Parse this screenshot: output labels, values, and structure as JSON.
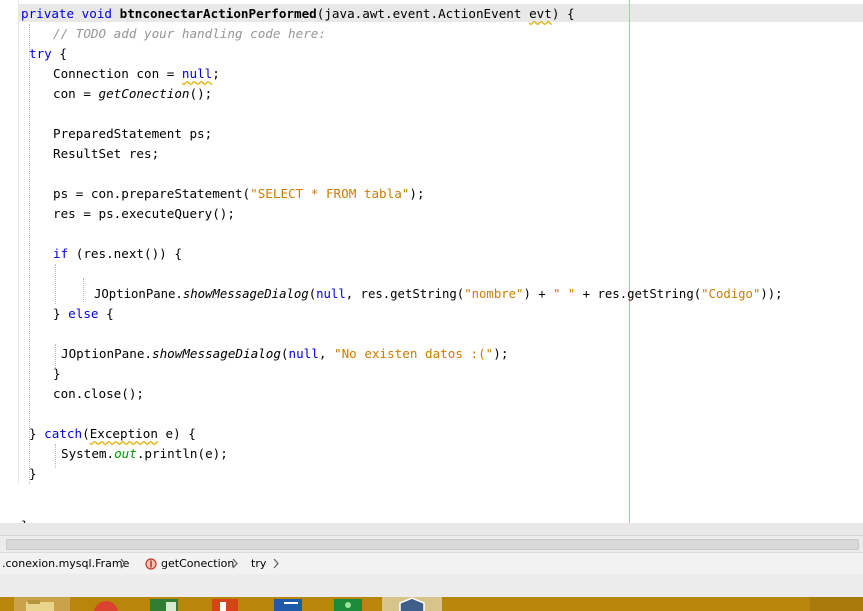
{
  "code": {
    "line1": {
      "kw_private": "private",
      "kw_void": "void",
      "method_name": "btnconectarActionPerformed",
      "params_start": "(java.awt.event.ActionEvent ",
      "param_name": "evt",
      "params_end": ") {"
    },
    "line2": {
      "comment": "// TODO add your handling code here:"
    },
    "line3": {
      "kw_try": "try",
      "rest": " {"
    },
    "line4": {
      "pre": "Connection con = ",
      "kw_null": "null",
      "post": ";"
    },
    "line5": {
      "pre": "con = ",
      "method": "getConection",
      "post": "();"
    },
    "line7": {
      "text": "PreparedStatement ps;"
    },
    "line8": {
      "text": "ResultSet res;"
    },
    "line10": {
      "pre": "ps = con.prepareStatement(",
      "str": "\"SELECT * FROM tabla\"",
      "post": ");"
    },
    "line11": {
      "text": "res = ps.executeQuery();"
    },
    "line13": {
      "kw_if": "if",
      "rest": " (res.next()) {"
    },
    "line15": {
      "pre": "JOptionPane.",
      "method": "showMessageDialog",
      "open": "(",
      "kw_null": "null",
      "mid1": ", res.getString(",
      "str1": "\"nombre\"",
      "mid2": ") + ",
      "str2": "\" \"",
      "mid3": " + res.getString(",
      "str3": "\"Codigo\"",
      "post": "));"
    },
    "line16": {
      "brace": "} ",
      "kw_else": "else",
      "rest": " {"
    },
    "line18": {
      "pre": "JOptionPane.",
      "method": "showMessageDialog",
      "open": "(",
      "kw_null": "null",
      "mid": ", ",
      "str": "\"No existen datos :(\"",
      "post": ");"
    },
    "line19": {
      "text": "}"
    },
    "line20": {
      "text": "con.close();"
    },
    "line22": {
      "brace": "} ",
      "kw_catch": "catch",
      "open": "(",
      "exc": "Exception",
      "rest": " e) {"
    },
    "line23": {
      "pre": "System.",
      "field": "out",
      "post": ".println(e);"
    },
    "line24": {
      "text": "}"
    },
    "line26": {
      "text": "}"
    }
  },
  "breadcrumb": {
    "class_item": ".conexion.mysql.Frame",
    "method_item": "getConection",
    "block_item": "try"
  },
  "icons": {
    "method": "method-icon",
    "chevron": "chevron-right-icon"
  },
  "colors": {
    "keyword": "#0000e6",
    "string": "#ce7b00",
    "comment": "#969696",
    "field": "#009900",
    "margin_line": "#f1a6a6",
    "taskbar": "#b8860b"
  }
}
